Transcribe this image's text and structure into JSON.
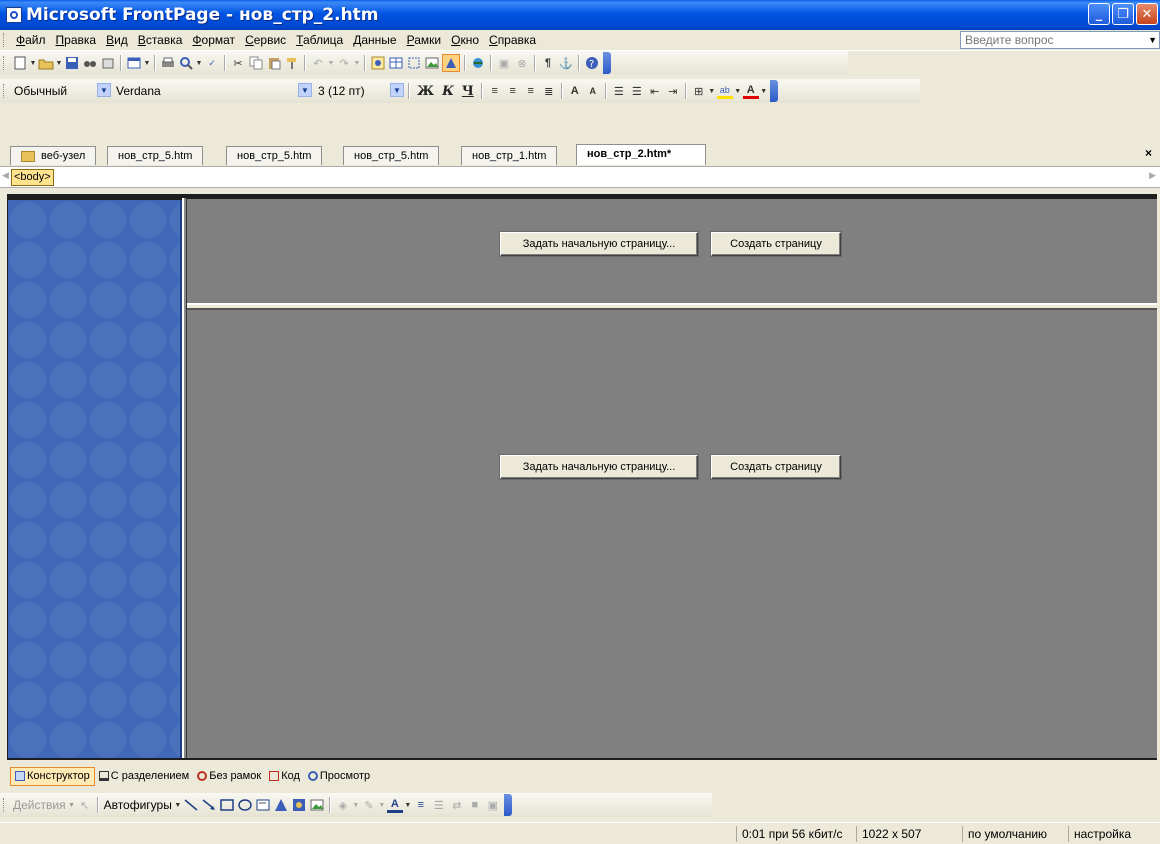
{
  "window": {
    "title": "Microsoft FrontPage - нов_стр_2.htm",
    "minimize": "_",
    "restore": "❐",
    "close": "✕"
  },
  "menu": {
    "items": [
      "Файл",
      "Правка",
      "Вид",
      "Вставка",
      "Формат",
      "Сервис",
      "Таблица",
      "Данные",
      "Рамки",
      "Окно",
      "Справка"
    ],
    "ask_placeholder": "Введите вопрос"
  },
  "format_toolbar": {
    "style": "Обычный",
    "font": "Verdana",
    "size": "3  (12 пт)",
    "bold": "Ж",
    "italic": "К",
    "underline": "Ч"
  },
  "tabs": {
    "items": [
      "веб-узел",
      "нов_стр_5.htm",
      "нов_стр_5.htm",
      "нов_стр_5.htm",
      "нов_стр_1.htm",
      "нов_стр_2.htm*"
    ],
    "close": "×"
  },
  "tagbar": {
    "tag": "<body>"
  },
  "frames": {
    "set_home_button": "Задать начальную страницу...",
    "create_page_button": "Создать страницу"
  },
  "views": [
    "Конструктор",
    "С разделением",
    "Без рамок",
    "Код",
    "Просмотр"
  ],
  "drawing": {
    "actions": "Действия",
    "autoshapes": "Автофигуры"
  },
  "status": {
    "timing": "0:01 при 56 кбит/с",
    "dimensions": "1022 x 507",
    "default": "по умолчанию",
    "custom": "настройка"
  }
}
